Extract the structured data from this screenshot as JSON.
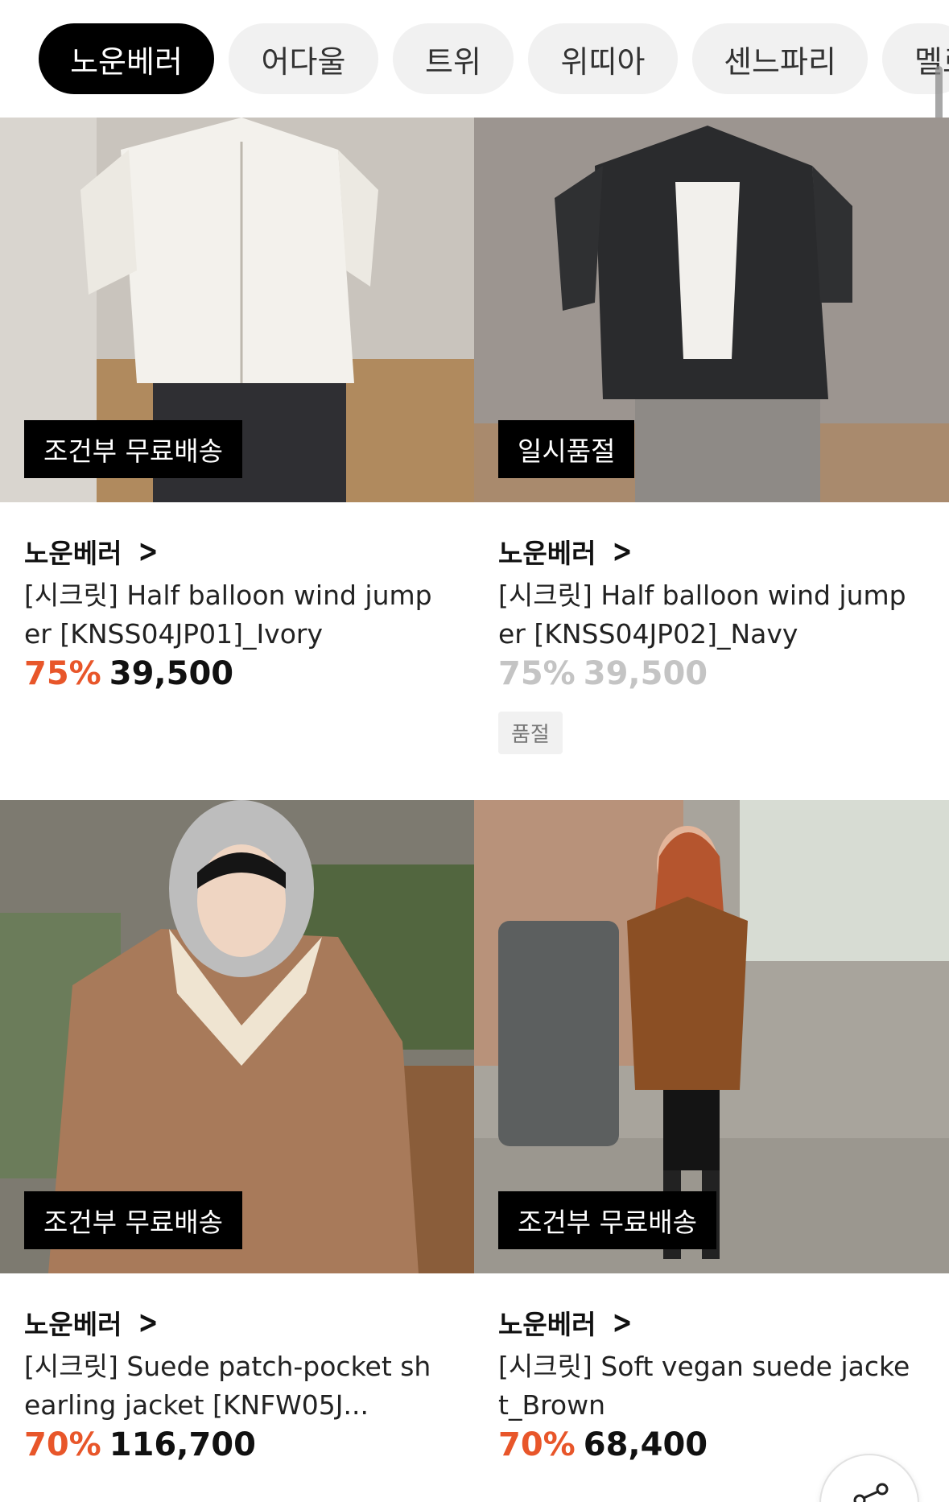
{
  "brand_chips": [
    {
      "label": "노운베러",
      "active": true
    },
    {
      "label": "어다울",
      "active": false
    },
    {
      "label": "트위",
      "active": false
    },
    {
      "label": "위띠아",
      "active": false
    },
    {
      "label": "센느파리",
      "active": false
    },
    {
      "label": "멜로",
      "active": false
    }
  ],
  "products": [
    {
      "tag": "조건부 무료배송",
      "brand": "노운베러",
      "name": "[시크릿] Half balloon wind jumper [KNSS04JP01]_Ivory",
      "discount": "75%",
      "price": "39,500",
      "sold_out": false
    },
    {
      "tag": "일시품절",
      "brand": "노운베러",
      "name": "[시크릿] Half balloon wind jumper [KNSS04JP02]_Navy",
      "discount": "75%",
      "price": "39,500",
      "sold_out": true,
      "sold_out_label": "품절"
    },
    {
      "tag": "조건부 무료배송",
      "brand": "노운베러",
      "name": "[시크릿] Suede patch-pocket shearling jacket [KNFW05J...",
      "discount": "70%",
      "price": "116,700",
      "sold_out": false
    },
    {
      "tag": "조건부 무료배송",
      "brand": "노운베러",
      "name": "[시크릿] Soft vegan suede jacket_Brown",
      "discount": "70%",
      "price": "68,400",
      "sold_out": false
    }
  ],
  "colors": {
    "discount": "#e8562a",
    "active_chip": "#000000",
    "chip": "#f1f1f1"
  },
  "icons": {
    "brand_arrow": "chevron-right-icon",
    "share": "share-icon"
  }
}
